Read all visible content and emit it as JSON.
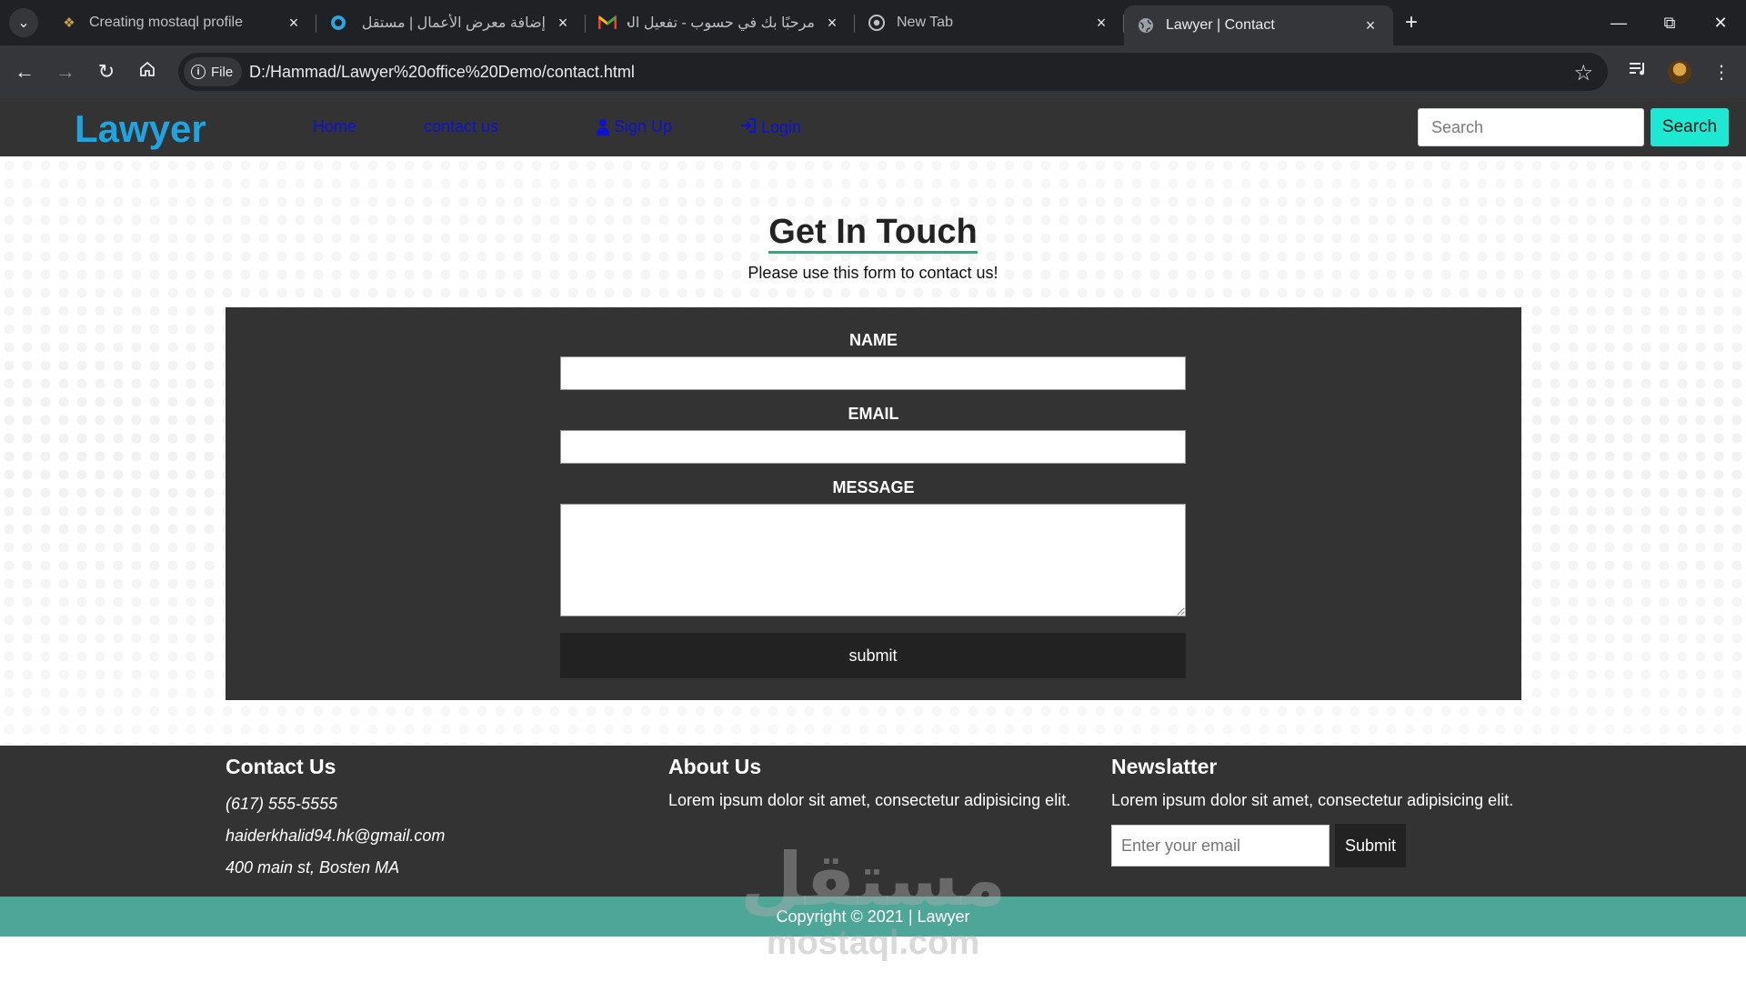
{
  "browser": {
    "tabs": [
      {
        "title": "Creating mostaql profile",
        "favicon": "pin-icon",
        "active": false
      },
      {
        "title": "إضافة معرض الأعمال | مستقل",
        "favicon": "mostaql-icon",
        "active": false
      },
      {
        "title": "مرحبًا بك في حسوب - تفعيل الحساب",
        "favicon": "gmail-icon",
        "active": false
      },
      {
        "title": "New Tab",
        "favicon": "chrome-icon",
        "active": false
      },
      {
        "title": "Lawyer | Contact",
        "favicon": "globe-icon",
        "active": true
      }
    ],
    "file_chip": "File",
    "url": "D:/Hammad/Lawyer%20office%20Demo/contact.html"
  },
  "site": {
    "brand": "Lawyer",
    "nav": {
      "home": "Home",
      "contact": "contact us",
      "signup": "Sign Up",
      "login": "Login"
    },
    "search": {
      "placeholder": "Search",
      "button": "Search"
    }
  },
  "contact": {
    "title": "Get In Touch",
    "subtitle": "Please use this form to contact us!",
    "form": {
      "name_label": "NAME",
      "email_label": "EMAIL",
      "message_label": "MESSAGE",
      "submit": "submit"
    }
  },
  "footer": {
    "contact": {
      "heading": "Contact Us",
      "phone": "(617) 555-5555",
      "email": "haiderkhalid94.hk@gmail.com",
      "address": "400 main st, Bosten MA"
    },
    "about": {
      "heading": "About Us",
      "text": "Lorem ipsum dolor sit amet, consectetur adipisicing elit."
    },
    "newsletter": {
      "heading": "Newslatter",
      "text": "Lorem ipsum dolor sit amet, consectetur adipisicing elit.",
      "placeholder": "Enter your email",
      "button": "Submit"
    },
    "copyright": "Copyright © 2021 | Lawyer"
  },
  "watermark": {
    "arabic": "مستقل",
    "latin": "mostaql.com"
  },
  "colors": {
    "brand": "#1fa4e0",
    "nav_link": "#0d11d4",
    "search_button": "#1de9d3",
    "copyright_bar": "#4ea699",
    "panel": "#333333",
    "title_underline": "#3aa37f"
  }
}
